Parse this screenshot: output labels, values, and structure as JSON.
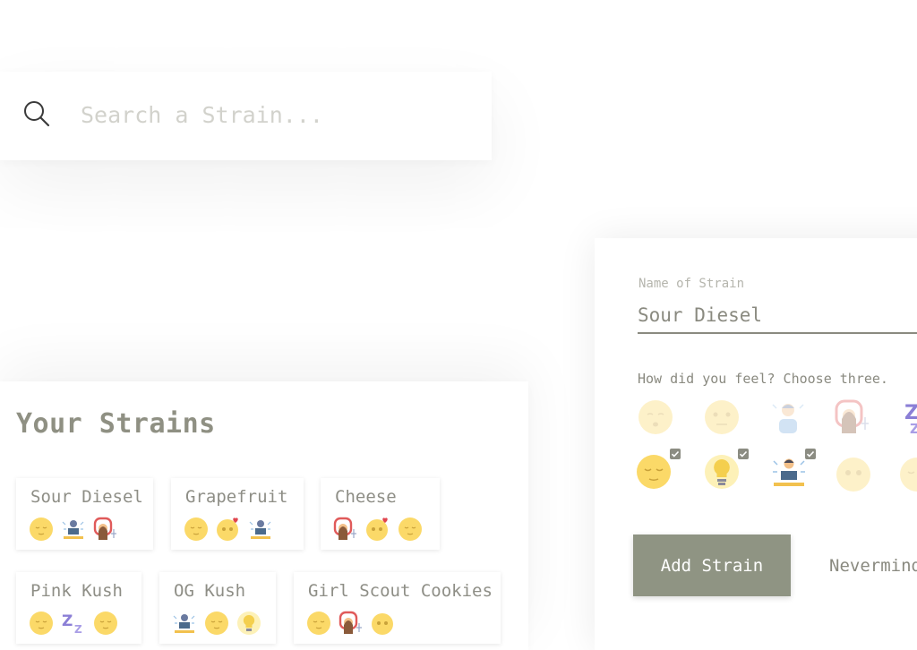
{
  "search": {
    "placeholder": "Search a Strain..."
  },
  "strains_section": {
    "title": "Your Strains",
    "strains": [
      {
        "name": "Sour Diesel",
        "feelings": [
          "relaxed-face-icon",
          "working-person-icon",
          "aroused-person-icon"
        ]
      },
      {
        "name": "Grapefruit",
        "feelings": [
          "relaxed-face-icon",
          "heart-eyes-face-icon",
          "working-person-icon"
        ]
      },
      {
        "name": "Cheese",
        "feelings": [
          "aroused-person-icon",
          "heart-eyes-face-icon",
          "relaxed-face-icon"
        ]
      },
      {
        "name": "Pink Kush",
        "feelings": [
          "relaxed-face-icon",
          "sleepy-zz-icon",
          "relaxed-face-icon"
        ]
      },
      {
        "name": "OG Kush",
        "feelings": [
          "working-person-icon",
          "relaxed-face-icon",
          "lightbulb-icon"
        ]
      },
      {
        "name": "Girl Scout Cookies",
        "feelings": [
          "relaxed-face-icon",
          "aroused-person-icon",
          "heart-eyes-face-icon"
        ]
      }
    ]
  },
  "add_form": {
    "name_label": "Name of Strain",
    "name_value": "Sour Diesel",
    "feel_prompt": "How did you feel? Choose three.",
    "feelings_row1": [
      {
        "icon": "sleepy-face-icon",
        "selected": false
      },
      {
        "icon": "uneasy-face-icon",
        "selected": false
      },
      {
        "icon": "focused-person-icon",
        "selected": false
      },
      {
        "icon": "aroused-person-icon",
        "selected": false
      },
      {
        "icon": "sleepy-zz-icon",
        "selected": false
      }
    ],
    "feelings_row2": [
      {
        "icon": "relaxed-face-icon",
        "selected": true
      },
      {
        "icon": "lightbulb-icon",
        "selected": true
      },
      {
        "icon": "working-person-icon",
        "selected": true
      },
      {
        "icon": "giggly-face-icon",
        "selected": false
      },
      {
        "icon": "relaxed-face-icon",
        "selected": false
      }
    ],
    "add_label": "Add Strain",
    "cancel_label": "Nevermind"
  }
}
